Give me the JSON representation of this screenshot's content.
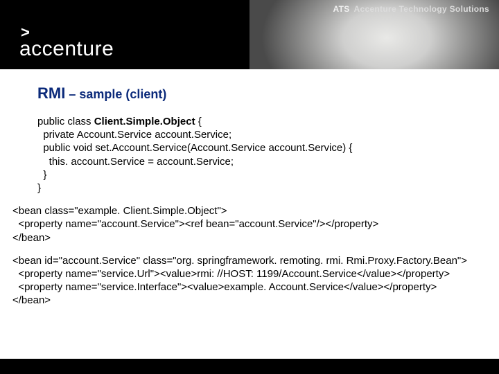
{
  "header": {
    "logo_gt": ">",
    "logo_name": "accenture",
    "badge_abbr": "ATS",
    "badge_text": "Accenture Technology Solutions"
  },
  "title": {
    "strong": "RMI",
    "rest": " – sample (client)"
  },
  "code": {
    "l1a": "public class ",
    "l1b": "Client.Simple.Object",
    "l1c": " {",
    "l2": "  private Account.Service account.Service;",
    "l3": "  public void set.Account.Service(Account.Service account.Service) {",
    "l4": "    this. account.Service = account.Service;",
    "l5": "  }",
    "l6": "}"
  },
  "xml1": {
    "l1": "<bean class=\"example. Client.Simple.Object\">",
    "l2": "  <property name=\"account.Service\"><ref bean=\"account.Service\"/></property>",
    "l3": "</bean>"
  },
  "xml2": {
    "l1": "<bean id=\"account.Service\" class=\"org. springframework. remoting. rmi. Rmi.Proxy.Factory.Bean\">",
    "l2": "  <property name=\"service.Url\"><value>rmi: //HOST: 1199/Account.Service</value></property>",
    "l3": "  <property name=\"service.Interface\"><value>example. Account.Service</value></property>",
    "l4": "</bean>"
  }
}
